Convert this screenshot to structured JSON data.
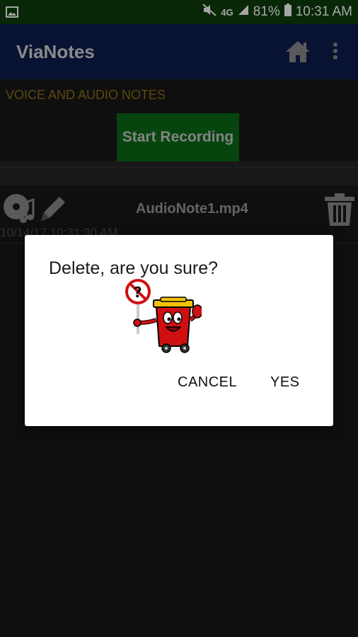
{
  "status_bar": {
    "network": "4G",
    "battery": "81%",
    "time": "10:31 AM"
  },
  "app_bar": {
    "title": "ViaNotes",
    "icons": [
      "home-icon",
      "more-vert-icon"
    ]
  },
  "main": {
    "section_label": "VOICE AND AUDIO NOTES",
    "record_button": "Start Recording",
    "notes": [
      {
        "name": "AudioNote1.mp4",
        "date": "10/14/17 10:31:30 AM"
      }
    ]
  },
  "dialog": {
    "title": "Delete, are you sure?",
    "cancel": "CANCEL",
    "yes": "YES"
  },
  "colors": {
    "status_bar": "#0c3d0c",
    "app_bar": "#0d1d4e",
    "record_button": "#0b6b18",
    "section_label": "#8e6f1a",
    "background": "#181818"
  }
}
